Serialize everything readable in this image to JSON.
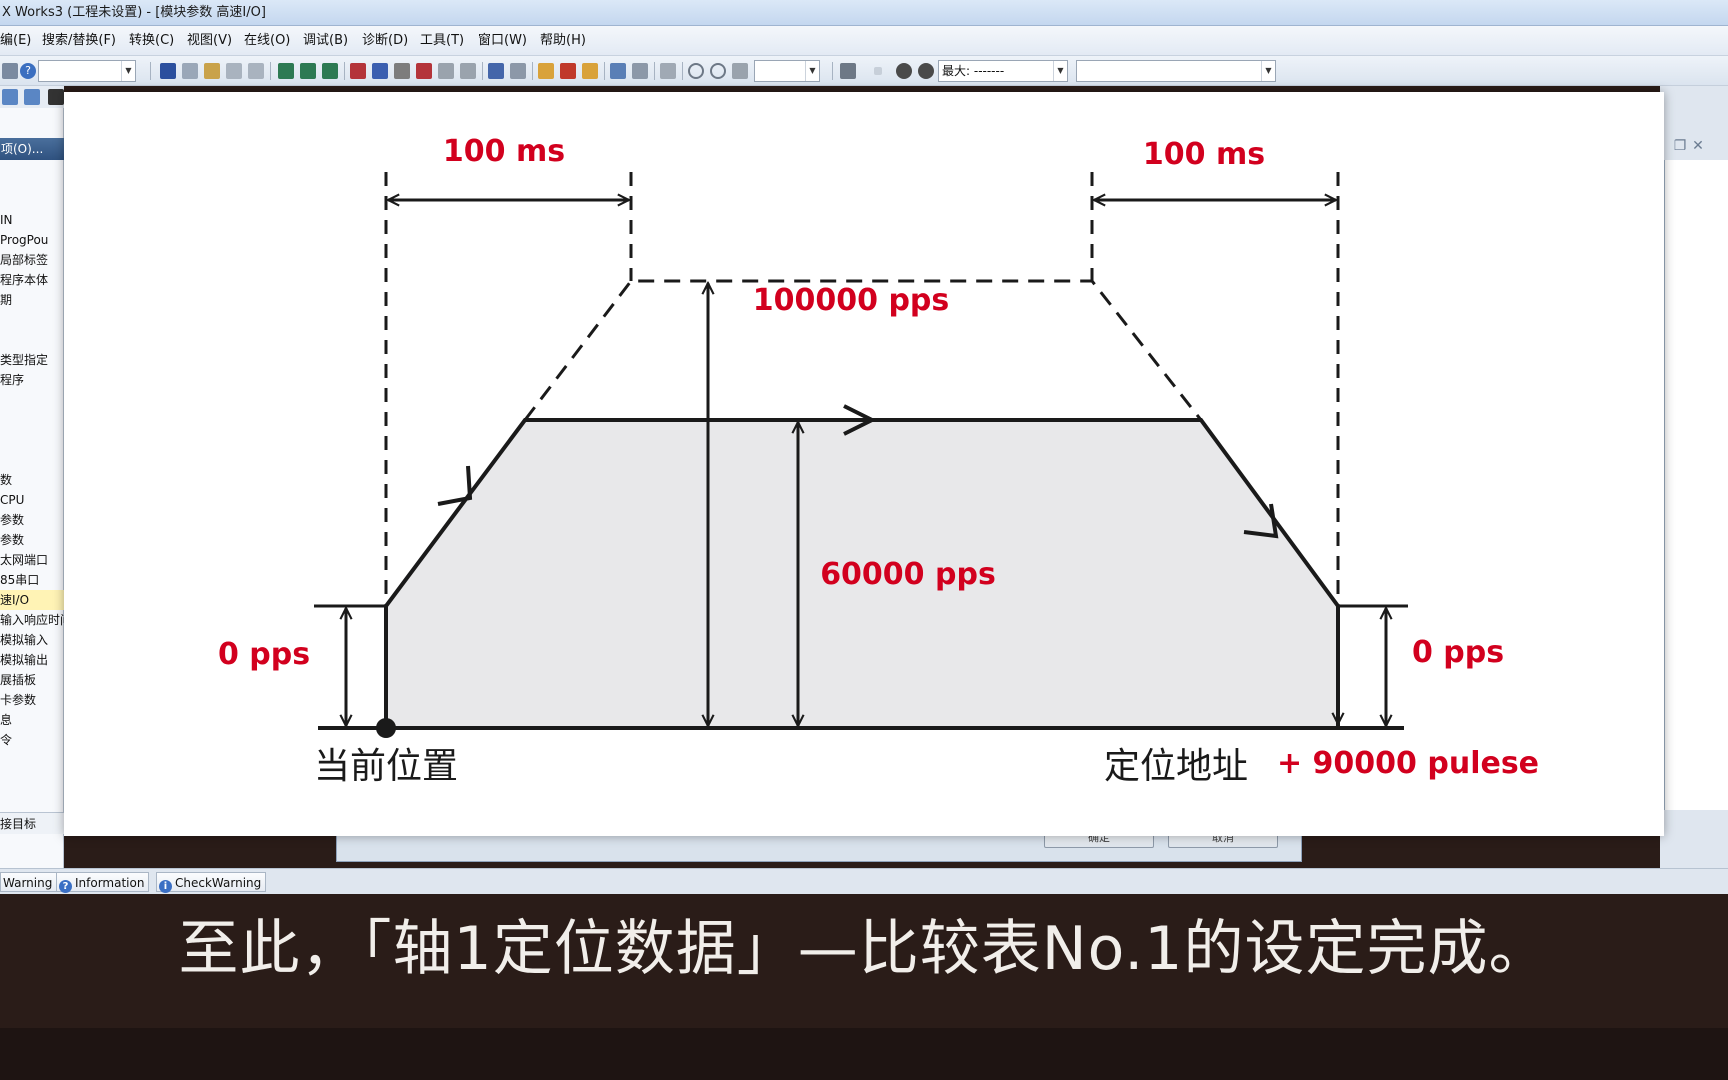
{
  "window": {
    "title": "X Works3 (工程未设置) - [模块参数 高速I/O]"
  },
  "menu": [
    "编(E)",
    "搜索/替换(F)",
    "转换(C)",
    "视图(V)",
    "在线(O)",
    "调试(B)",
    "诊断(D)",
    "工具(T)",
    "窗口(W)",
    "帮助(H)"
  ],
  "toolbar": {
    "combo1_value": "",
    "combo2_value": "",
    "max_label": "最大: -------",
    "combo4_value": ""
  },
  "nav": {
    "header": "项(O)...",
    "items": [
      "IN",
      "ProgPou",
      "局部标签",
      "程序本体",
      "期",
      "",
      "类型指定",
      "程序",
      "",
      "",
      "数",
      "CPU",
      "参数",
      "参数",
      "太网端口",
      "85串口",
      "速I/O",
      "输入响应时间",
      "模拟输入",
      "模拟输出",
      "展插板",
      "卡参数",
      "息",
      "令"
    ],
    "selected_index": 16,
    "bottom": "接目标"
  },
  "dialog": {
    "ok_label": "确定",
    "cancel_label": "取消"
  },
  "diagram": {
    "accel_time": "100 ms",
    "decel_time": "100 ms",
    "max_speed": "100000 pps",
    "run_speed": "60000 pps",
    "start_speed_left": "0 pps",
    "start_speed_right": "0 pps",
    "start_label": "当前位置",
    "end_label": "定位地址",
    "target_label": "+ 90000 pulese",
    "accent_color": "#d2001e"
  },
  "status_tabs": [
    "Warning",
    "Information",
    "CheckWarning"
  ],
  "subtitle": "至此，「轴1定位数据」—比较表No.1的设定完成。"
}
